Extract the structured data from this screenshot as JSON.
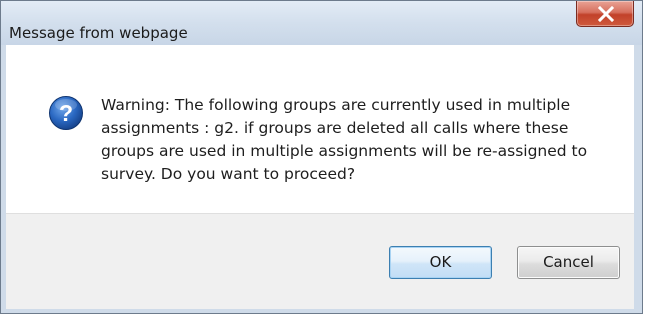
{
  "dialog": {
    "title": "Message from webpage",
    "icon": "question-icon",
    "message": "Warning: The following groups are currently used in multiple assignments : g2. if groups are deleted all calls where these groups are used in multiple assignments will be re-assigned to survey. Do you want to proceed?",
    "buttons": {
      "ok_label": "OK",
      "cancel_label": "Cancel"
    },
    "close_icon": "close-icon",
    "colors": {
      "titlebar": "#d3dfed",
      "close_button": "#c2412a",
      "question_icon": "#1f5fb0",
      "button_bar": "#f0f0f0",
      "ok_border": "#3c7fb1"
    }
  }
}
